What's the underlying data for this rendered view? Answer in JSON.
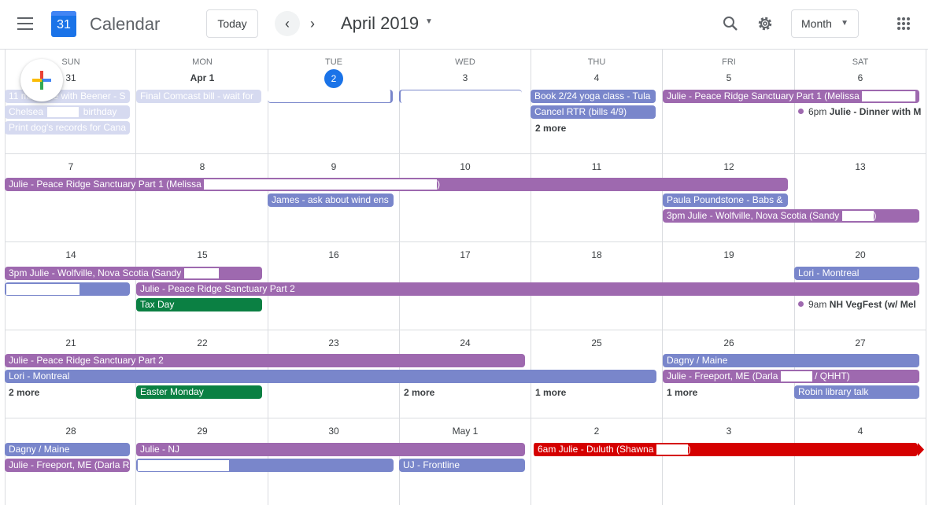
{
  "header": {
    "app_name": "Calendar",
    "logo_day": "31",
    "today_label": "Today",
    "month_title": "April 2019",
    "view_label": "Month"
  },
  "icons": [
    "menu-icon",
    "calendar-logo-icon",
    "chevron-left-icon",
    "chevron-right-icon",
    "search-icon",
    "gear-icon",
    "apps-icon",
    "plus-icon"
  ],
  "weekdays": [
    "SUN",
    "MON",
    "TUE",
    "WED",
    "THU",
    "FRI",
    "SAT"
  ],
  "weeks": [
    [
      "31",
      "Apr 1",
      "2",
      "3",
      "4",
      "5",
      "6"
    ],
    [
      "7",
      "8",
      "9",
      "10",
      "11",
      "12",
      "13"
    ],
    [
      "14",
      "15",
      "16",
      "17",
      "18",
      "19",
      "20"
    ],
    [
      "21",
      "22",
      "23",
      "24",
      "25",
      "26",
      "27"
    ],
    [
      "28",
      "29",
      "30",
      "May 1",
      "2",
      "3",
      "4"
    ]
  ],
  "events": {
    "w1": {
      "hike": "11 mile hike with Beener - S",
      "chelsea_a": "Chelsea",
      "chelsea_b": "birthday",
      "dog": "Print dog's records for Cana",
      "comcast": "Final Comcast bill - wait for",
      "yoga": "Book 2/24 yoga class - Tula",
      "rtr": "Cancel RTR (bills 4/9)",
      "thu_more": "2 more",
      "peace1": "Julie - Peace Ridge Sanctuary Part 1 (Melissa",
      "dinner_time": "6pm",
      "dinner": "Julie - Dinner with M"
    },
    "w2": {
      "peace1": "Julie - Peace Ridge Sanctuary Part 1 (Melissa",
      "peace1_end": ")",
      "james": "James - ask about wind ens",
      "paula": "Paula Poundstone - Babs &",
      "wolfville": "3pm Julie - Wolfville, Nova Scotia (Sandy",
      "wolfville_end": ")"
    },
    "w3": {
      "wolfville": "3pm Julie - Wolfville, Nova Scotia (Sandy",
      "peace2": "Julie - Peace Ridge Sanctuary Part 2",
      "taxday": "Tax Day",
      "lori": "Lori - Montreal",
      "vegfest_time": "9am",
      "vegfest": "NH VegFest (w/ Mel"
    },
    "w4": {
      "peace2": "Julie - Peace Ridge Sanctuary Part 2",
      "lori": "Lori - Montreal",
      "sun_more": "2 more",
      "easter": "Easter Monday",
      "wed_more": "2 more",
      "thu_more": "1 more",
      "dagny": "Dagny / Maine",
      "freeport": "Julie - Freeport, ME (Darla",
      "freeport_end": "/ QHHT)",
      "fri_more": "1 more",
      "robin": "Robin library talk"
    },
    "w5": {
      "dagny": "Dagny / Maine",
      "freeport": "Julie - Freeport, ME (Darla R",
      "nj": "Julie - NJ",
      "frontline": "UJ - Frontline",
      "duluth": "6am Julie - Duluth (Shawna",
      "duluth_end": ")"
    }
  },
  "colors": {
    "purple": "#9e69af",
    "blue": "#7986cb",
    "green": "#0b8043",
    "red": "#d50000",
    "today": "#1a73e8"
  }
}
